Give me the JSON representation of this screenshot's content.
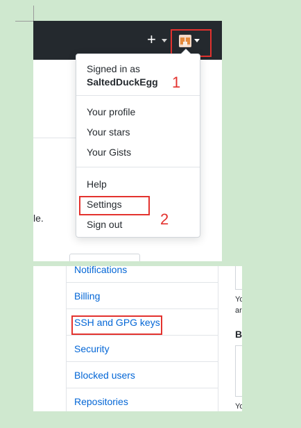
{
  "header": {
    "plus_label": "+",
    "plus_icon": "plus-icon",
    "avatar_icon": "avatar-icon"
  },
  "background": {
    "fragment_text": "le."
  },
  "dropdown": {
    "signed_in_label": "Signed in as",
    "username": "SaltedDuckEgg",
    "items_group1": [
      "Your profile",
      "Your stars",
      "Your Gists"
    ],
    "items_group2": [
      "Help",
      "Settings",
      "Sign out"
    ]
  },
  "annotations": {
    "step1": "1",
    "step2": "2",
    "highlight_color": "#e3322e"
  },
  "settings_menu": {
    "items": [
      "Notifications",
      "Billing",
      "SSH and GPG keys",
      "Security",
      "Blocked users",
      "Repositories"
    ],
    "link_color": "#0366d6"
  },
  "side_fragments": {
    "t1": "Yo",
    "t2": "ar",
    "heading": "B",
    "t3": "Yo"
  }
}
